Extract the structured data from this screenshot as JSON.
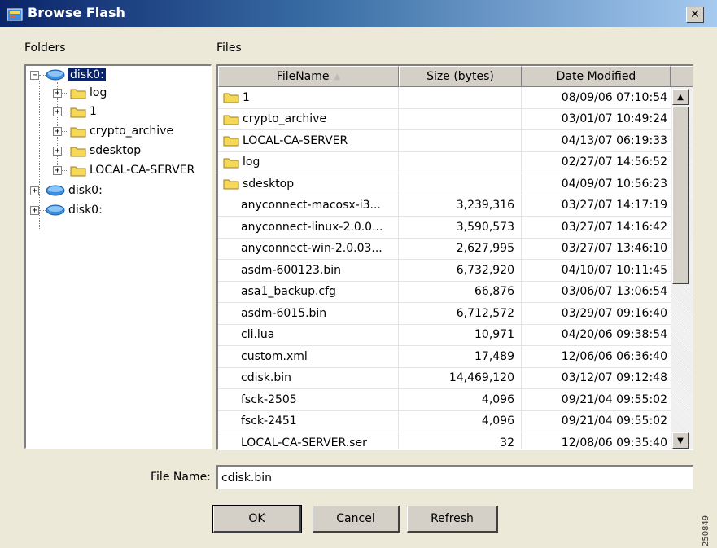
{
  "window": {
    "title": "Browse Flash",
    "close_symbol": "✕"
  },
  "labels": {
    "folders": "Folders",
    "files": "Files",
    "file_name": "File Name:"
  },
  "tree": {
    "root": "disk0:",
    "children": [
      "log",
      "1",
      "crypto_archive",
      "sdesktop",
      "LOCAL-CA-SERVER"
    ],
    "others": [
      "disk0:",
      "disk0:"
    ]
  },
  "table": {
    "columns": [
      "FileName",
      "Size (bytes)",
      "Date Modified"
    ],
    "sort_indicator": "▲",
    "rows": [
      {
        "name": "1",
        "size": "",
        "date": "08/09/06 07:10:54",
        "folder": true
      },
      {
        "name": "crypto_archive",
        "size": "",
        "date": "03/01/07 10:49:24",
        "folder": true
      },
      {
        "name": "LOCAL-CA-SERVER",
        "size": "",
        "date": "04/13/07 06:19:33",
        "folder": true
      },
      {
        "name": "log",
        "size": "",
        "date": "02/27/07 14:56:52",
        "folder": true
      },
      {
        "name": "sdesktop",
        "size": "",
        "date": "04/09/07 10:56:23",
        "folder": true
      },
      {
        "name": "anyconnect-macosx-i3...",
        "size": "3,239,316",
        "date": "03/27/07 14:17:19",
        "folder": false
      },
      {
        "name": "anyconnect-linux-2.0.0...",
        "size": "3,590,573",
        "date": "03/27/07 14:16:42",
        "folder": false
      },
      {
        "name": "anyconnect-win-2.0.03...",
        "size": "2,627,995",
        "date": "03/27/07 13:46:10",
        "folder": false
      },
      {
        "name": "asdm-600123.bin",
        "size": "6,732,920",
        "date": "04/10/07 10:11:45",
        "folder": false
      },
      {
        "name": "asa1_backup.cfg",
        "size": "66,876",
        "date": "03/06/07 13:06:54",
        "folder": false
      },
      {
        "name": "asdm-6015.bin",
        "size": "6,712,572",
        "date": "03/29/07 09:16:40",
        "folder": false
      },
      {
        "name": "cli.lua",
        "size": "10,971",
        "date": "04/20/06 09:38:54",
        "folder": false
      },
      {
        "name": "custom.xml",
        "size": "17,489",
        "date": "12/06/06 06:36:40",
        "folder": false
      },
      {
        "name": "cdisk.bin",
        "size": "14,469,120",
        "date": "03/12/07 09:12:48",
        "folder": false
      },
      {
        "name": "fsck-2505",
        "size": "4,096",
        "date": "09/21/04 09:55:02",
        "folder": false
      },
      {
        "name": "fsck-2451",
        "size": "4,096",
        "date": "09/21/04 09:55:02",
        "folder": false
      },
      {
        "name": "LOCAL-CA-SERVER.ser",
        "size": "32",
        "date": "12/08/06 09:35:40",
        "folder": false
      }
    ]
  },
  "file_name_value": "cdisk.bin",
  "buttons": {
    "ok": "OK",
    "cancel": "Cancel",
    "refresh": "Refresh"
  },
  "figure_id": "250849",
  "colors": {
    "title_start": "#0a246a",
    "title_end": "#a6caf0",
    "folder_yellow": "#f5d75a",
    "disk_blue": "#3b8fe0",
    "selection": "#0a246a"
  }
}
